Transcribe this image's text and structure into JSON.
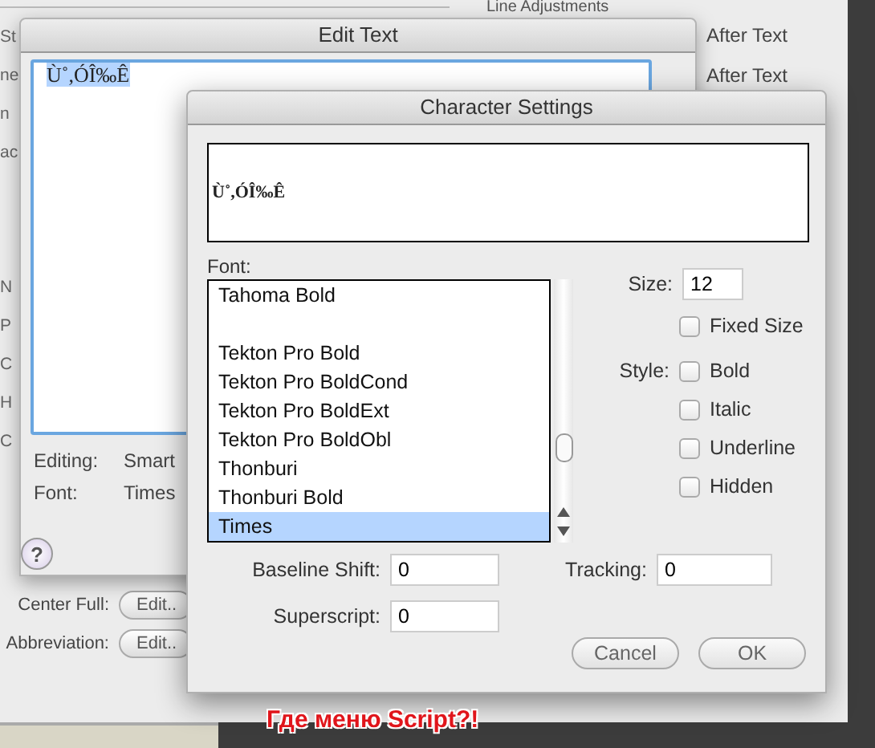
{
  "background_window": {
    "group_title": "Line Adjustments",
    "left_labels": [
      "St",
      "ne",
      "n",
      "ac",
      "N",
      "P",
      "C",
      "H",
      "C"
    ],
    "after_text": [
      {
        "label": "After Text"
      },
      {
        "label": "After Text"
      }
    ],
    "edit_rows": [
      {
        "label": "Center Full:",
        "button": "Edit.."
      },
      {
        "label": "Abbreviation:",
        "button": "Edit.."
      }
    ]
  },
  "edit_text": {
    "title": "Edit Text",
    "text": "Ù˚,ÓÎ‰Ê",
    "text_selected": true,
    "info": [
      {
        "label": "Editing:",
        "value": "Smart"
      },
      {
        "label": "Font:",
        "value": "Times"
      }
    ],
    "help": "?"
  },
  "character_settings": {
    "title": "Character Settings",
    "preview": "Ù˚,ÓÎ‰Ê",
    "font_label": "Font:",
    "fonts": [
      {
        "kind": "font",
        "name": "Tahoma Bold",
        "selected": false
      },
      {
        "kind": "separator"
      },
      {
        "kind": "font",
        "name": "Tekton Pro Bold",
        "selected": false
      },
      {
        "kind": "font",
        "name": "Tekton Pro BoldCond",
        "selected": false
      },
      {
        "kind": "font",
        "name": "Tekton Pro BoldExt",
        "selected": false
      },
      {
        "kind": "font",
        "name": "Tekton Pro BoldObl",
        "selected": false
      },
      {
        "kind": "font",
        "name": "Thonburi",
        "selected": false
      },
      {
        "kind": "font",
        "name": "Thonburi Bold",
        "selected": false
      },
      {
        "kind": "font",
        "name": "Times",
        "selected": true
      }
    ],
    "size_label": "Size:",
    "size": "12",
    "fixed_size": {
      "label": "Fixed Size",
      "checked": false
    },
    "style_label": "Style:",
    "styles": [
      {
        "label": "Bold",
        "checked": false
      },
      {
        "label": "Italic",
        "checked": false
      },
      {
        "label": "Underline",
        "checked": false
      },
      {
        "label": "Hidden",
        "checked": false
      }
    ],
    "fields": [
      {
        "label": "Baseline Shift:",
        "value": "0"
      },
      {
        "label": "Tracking:",
        "value": "0"
      },
      {
        "label": "Superscript:",
        "value": "0"
      }
    ],
    "buttons": [
      "Cancel",
      "OK"
    ]
  },
  "annotation": "Где меню Script?!"
}
